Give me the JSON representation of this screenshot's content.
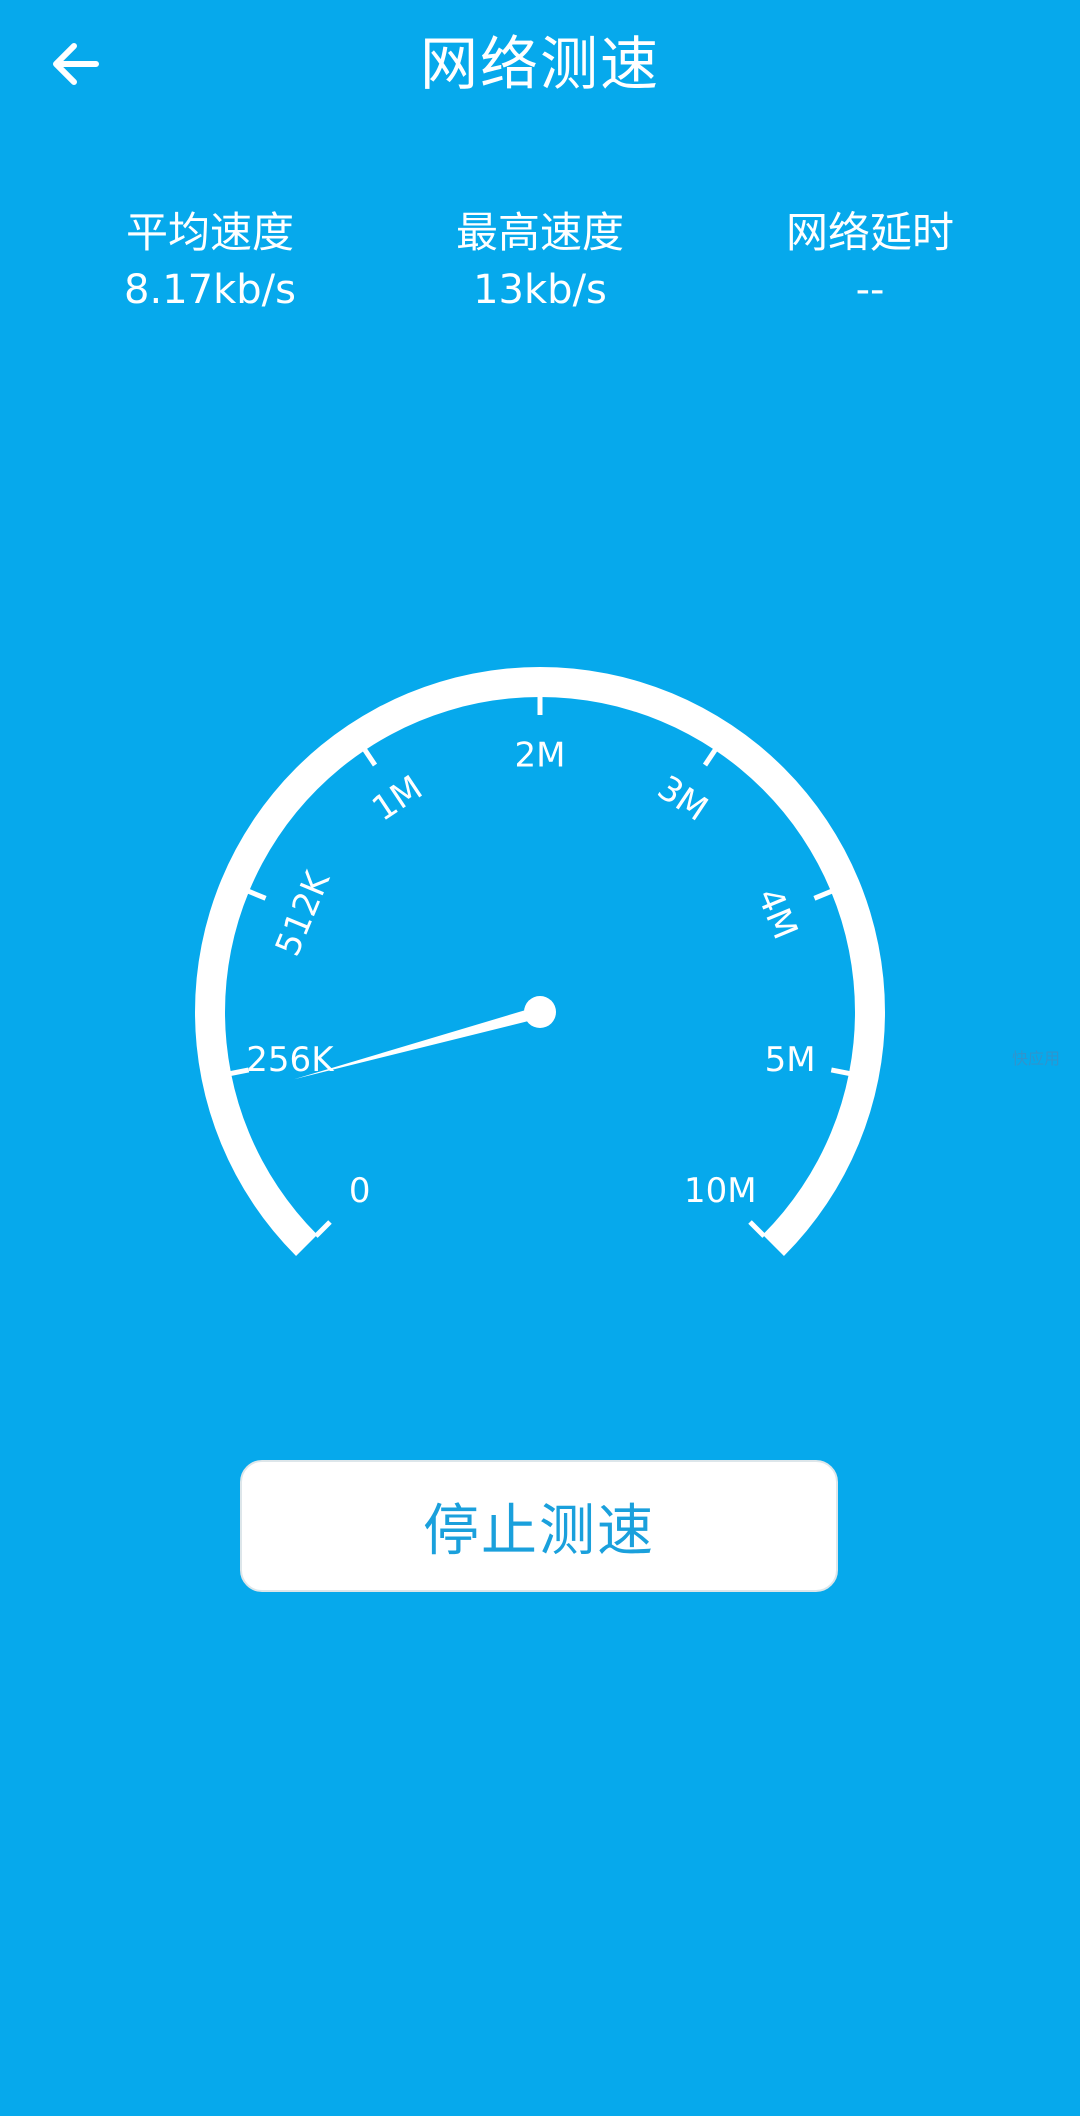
{
  "header": {
    "title": "网络测速",
    "back_icon": "arrow-left-icon"
  },
  "stats": {
    "avg_label": "平均速度",
    "avg_value": "8.17kb/s",
    "max_label": "最高速度",
    "max_value": "13kb/s",
    "latency_label": "网络延时",
    "latency_value": "--"
  },
  "gauge": {
    "ticks": [
      "0",
      "256K",
      "512K",
      "1M",
      "2M",
      "3M",
      "4M",
      "5M",
      "10M"
    ],
    "needle_fraction": 0.11,
    "dial_color": "#ffffff"
  },
  "action": {
    "stop_label": "停止测速"
  },
  "colors": {
    "background": "#06a9ec",
    "button_text": "#1aa0dc"
  },
  "watermark": "快应用"
}
